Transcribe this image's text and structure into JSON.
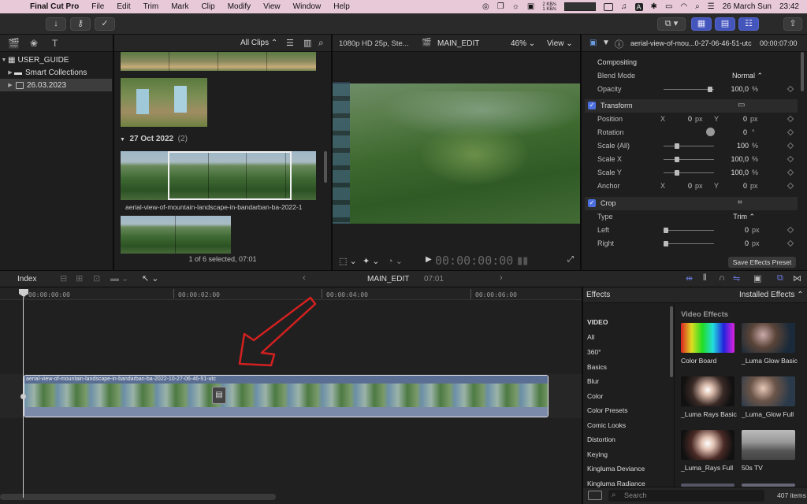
{
  "menubar": {
    "app": "Final Cut Pro",
    "items": [
      "File",
      "Edit",
      "Trim",
      "Mark",
      "Clip",
      "Modify",
      "View",
      "Window",
      "Help"
    ],
    "net_up": "2 KB/s",
    "net_down": "1 KB/s",
    "date": "26 March Sun",
    "time": "23:42"
  },
  "library": {
    "items": [
      {
        "label": "USER_GUIDE"
      },
      {
        "label": "Smart Collections"
      },
      {
        "label": "26.03.2023"
      }
    ]
  },
  "browser": {
    "filter": "All Clips",
    "date_group": "27 Oct 2022",
    "date_count": "(2)",
    "clip_name": "aerial-view-of-mountain-landscape-in-bandarban-ba-2022-1",
    "status": "1 of 6 selected, 07:01"
  },
  "viewer": {
    "format": "1080p HD 25p, Ste...",
    "project": "MAIN_EDIT",
    "zoom": "46%",
    "view": "View",
    "timecode": "00:00:00:00"
  },
  "inspector": {
    "clip_title": "aerial-view-of-mou...0-27-06-46-51-utc",
    "duration": "00:00:07:00",
    "compositing_label": "Compositing",
    "blend_mode_label": "Blend Mode",
    "blend_mode": "Normal",
    "opacity_label": "Opacity",
    "opacity": "100,0",
    "transform_label": "Transform",
    "position_label": "Position",
    "pos_x": "0",
    "pos_y": "0",
    "rotation_label": "Rotation",
    "rotation": "0",
    "scale_all_label": "Scale (All)",
    "scale_all": "100",
    "scale_x_label": "Scale X",
    "scale_x": "100,0",
    "scale_y_label": "Scale Y",
    "scale_y": "100,0",
    "anchor_label": "Anchor",
    "anchor_x": "0",
    "anchor_y": "0",
    "crop_label": "Crop",
    "type_label": "Type",
    "type": "Trim",
    "left_label": "Left",
    "left": "0",
    "right_label": "Right",
    "right": "0",
    "save_preset": "Save Effects Preset",
    "x": "X",
    "y": "Y",
    "px": "px",
    "pct": "%",
    "deg": "°"
  },
  "timeline": {
    "index": "Index",
    "project": "MAIN_EDIT",
    "duration": "07:01",
    "ruler": [
      "00:00:00:00",
      "00:00:02:00",
      "00:00:04:00",
      "00:00:06:00"
    ],
    "clip_name": "aerial-view-of-mountain-landscape-in-bandarban-ba-2022-10-27-06-46-51-utc"
  },
  "effects": {
    "title": "Effects",
    "installed": "Installed Effects",
    "section": "Video Effects",
    "categories": [
      "VIDEO",
      "All",
      "360°",
      "Basics",
      "Blur",
      "Color",
      "Color Presets",
      "Comic Looks",
      "Distortion",
      "Keying",
      "Kingluma Deviance",
      "Kingluma Radiance"
    ],
    "items": [
      "Color Board",
      "_Luma Glow Basic",
      "_Luma Rays Basic",
      "_Luma_Glow Full",
      "_Luma_Rays Full",
      "50s TV"
    ],
    "search_placeholder": "Search",
    "count": "407 items"
  }
}
